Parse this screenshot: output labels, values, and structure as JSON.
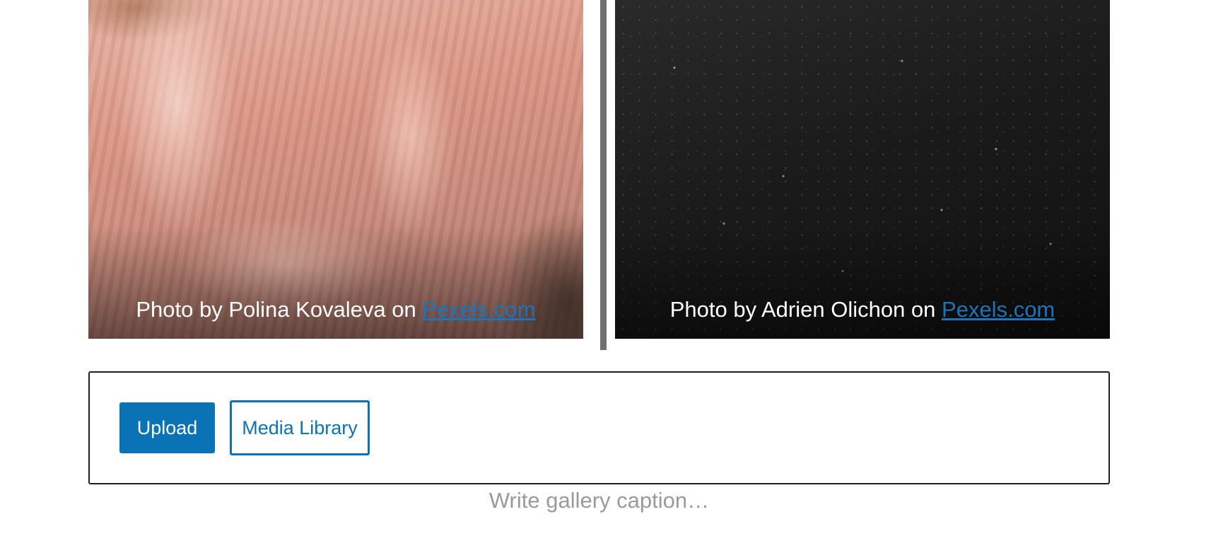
{
  "gallery": {
    "images": [
      {
        "caption_prefix": "Photo by Polina Kovaleva on ",
        "caption_link": "Pexels.com"
      },
      {
        "caption_prefix": "Photo by Adrien Olichon on ",
        "caption_link": "Pexels.com"
      }
    ],
    "placeholder": {
      "upload_label": "Upload",
      "media_library_label": "Media Library"
    },
    "caption_placeholder": "Write gallery caption…"
  },
  "colors": {
    "accent": "#0a73b5",
    "link": "#1c74b8",
    "separator": "#707070",
    "border": "#1e1e1e",
    "placeholder_text": "#9a9a9a"
  }
}
